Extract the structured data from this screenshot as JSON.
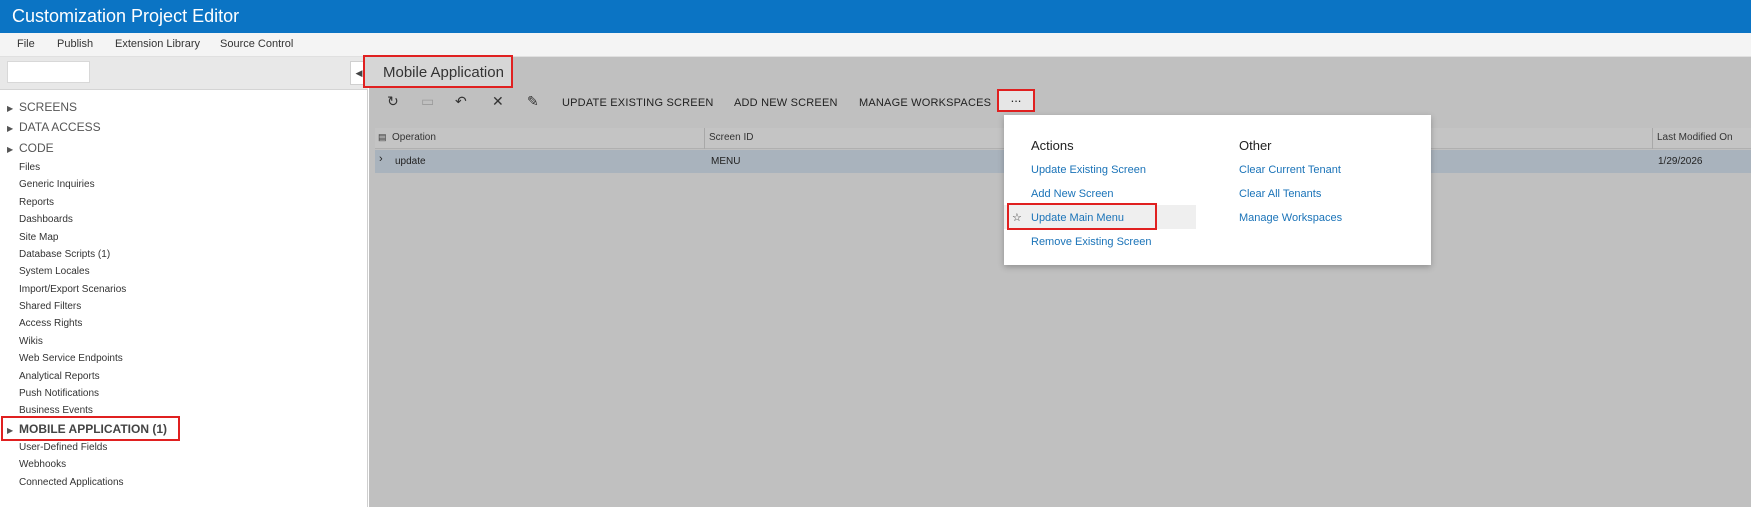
{
  "app": {
    "title": "Customization Project Editor"
  },
  "menubar": {
    "items": [
      "File",
      "Publish",
      "Extension Library",
      "Source Control"
    ]
  },
  "tree": {
    "categories": {
      "screens": "SCREENS",
      "data_access": "DATA ACCESS",
      "code": "CODE",
      "mobile_application": "MOBILE APPLICATION (1)"
    },
    "items": [
      "Files",
      "Generic Inquiries",
      "Reports",
      "Dashboards",
      "Site Map",
      "Database Scripts (1)",
      "System Locales",
      "Import/Export Scenarios",
      "Shared Filters",
      "Access Rights",
      "Wikis",
      "Web Service Endpoints",
      "Analytical Reports",
      "Push Notifications",
      "Business Events"
    ],
    "items_after": [
      "User-Defined Fields",
      "Webhooks",
      "Connected Applications"
    ]
  },
  "page": {
    "title": "Mobile Application"
  },
  "toolbar": {
    "update_existing": "UPDATE EXISTING SCREEN",
    "add_new": "ADD NEW SCREEN",
    "manage_workspaces": "MANAGE WORKSPACES",
    "more": "...",
    "icons": [
      "refresh-icon",
      "save-icon",
      "undo-icon",
      "delete-icon",
      "edit-icon"
    ]
  },
  "grid": {
    "columns": {
      "operation": "Operation",
      "screen_id": "Screen ID",
      "last_modified": "Last Modified On"
    },
    "rows": [
      {
        "operation": "update",
        "screen_id": "MENU",
        "last_modified": "1/29/2026"
      }
    ]
  },
  "dropdown": {
    "actions_header": "Actions",
    "actions": [
      "Update Existing Screen",
      "Add New Screen",
      "Update Main Menu",
      "Remove Existing Screen"
    ],
    "other_header": "Other",
    "other": [
      "Clear Current Tenant",
      "Clear All Tenants",
      "Manage Workspaces"
    ]
  },
  "colors": {
    "accent": "#0b74c4",
    "link": "#1a73b8",
    "highlight": "#e02020",
    "selected_row": "#a9b3bd"
  }
}
